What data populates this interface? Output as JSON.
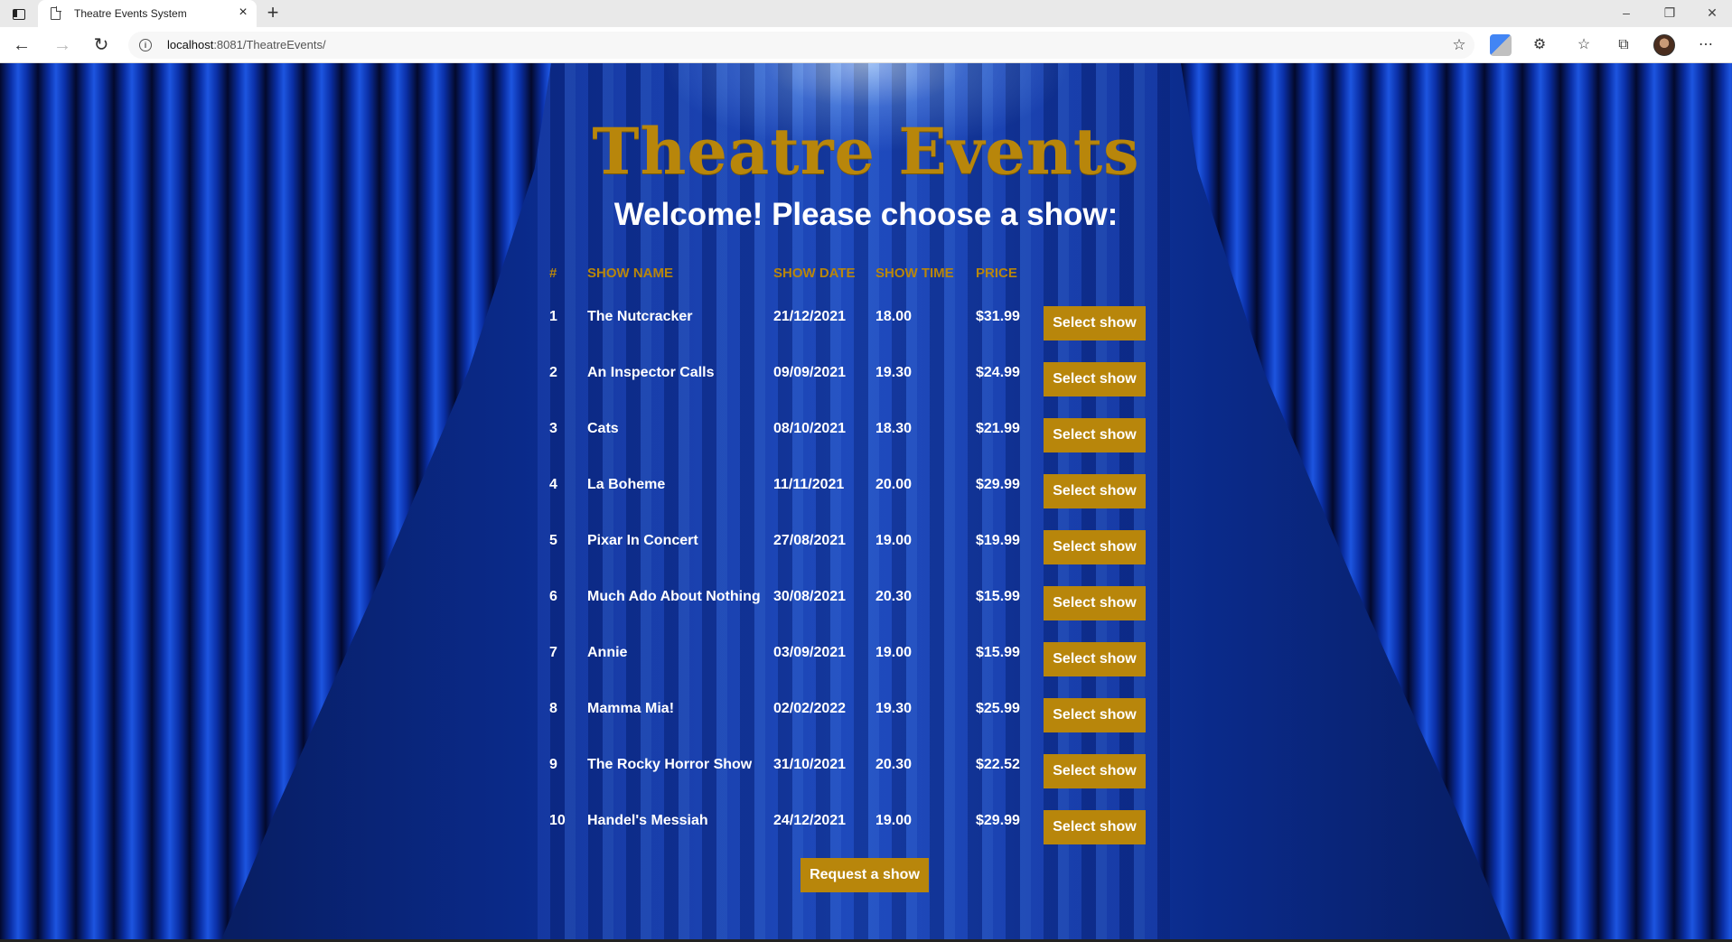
{
  "browser": {
    "tab_title": "Theatre Events System",
    "tab_close": "×",
    "new_tab": "+",
    "url_host": "localhost",
    "url_rest": ":8081/TheatreEvents/",
    "minimize": "–",
    "restore": "❐",
    "close": "✕",
    "back": "←",
    "forward": "→",
    "reload": "↻",
    "info": "i",
    "favorite": "☆",
    "extensions": "⚙",
    "favorites": "☆",
    "collections": "⧉",
    "more": "⋯"
  },
  "page": {
    "title": "Theatre Events",
    "subtitle": "Welcome! Please choose a show:",
    "columns": [
      "#",
      "SHOW NAME",
      "SHOW DATE",
      "SHOW TIME",
      "PRICE"
    ],
    "select_label": "Select show",
    "request_label": "Request a show",
    "shows": [
      {
        "num": "1",
        "name": "The Nutcracker",
        "date": "21/12/2021",
        "time": "18.00",
        "price": "$31.99"
      },
      {
        "num": "2",
        "name": "An Inspector Calls",
        "date": "09/09/2021",
        "time": "19.30",
        "price": "$24.99"
      },
      {
        "num": "3",
        "name": "Cats",
        "date": "08/10/2021",
        "time": "18.30",
        "price": "$21.99"
      },
      {
        "num": "4",
        "name": "La Boheme",
        "date": "11/11/2021",
        "time": "20.00",
        "price": "$29.99"
      },
      {
        "num": "5",
        "name": "Pixar In Concert",
        "date": "27/08/2021",
        "time": "19.00",
        "price": "$19.99"
      },
      {
        "num": "6",
        "name": "Much Ado About Nothing",
        "date": "30/08/2021",
        "time": "20.30",
        "price": "$15.99"
      },
      {
        "num": "7",
        "name": "Annie",
        "date": "03/09/2021",
        "time": "19.00",
        "price": "$15.99"
      },
      {
        "num": "8",
        "name": "Mamma Mia!",
        "date": "02/02/2022",
        "time": "19.30",
        "price": "$25.99"
      },
      {
        "num": "9",
        "name": "The Rocky Horror Show",
        "date": "31/10/2021",
        "time": "20.30",
        "price": "$22.52"
      },
      {
        "num": "10",
        "name": "Handel's Messiah",
        "date": "24/12/2021",
        "time": "19.00",
        "price": "$29.99"
      }
    ]
  },
  "colors": {
    "accent_gold": "#b8860b",
    "curtain_blue": "#1d55e0",
    "text_white": "#ffffff"
  }
}
